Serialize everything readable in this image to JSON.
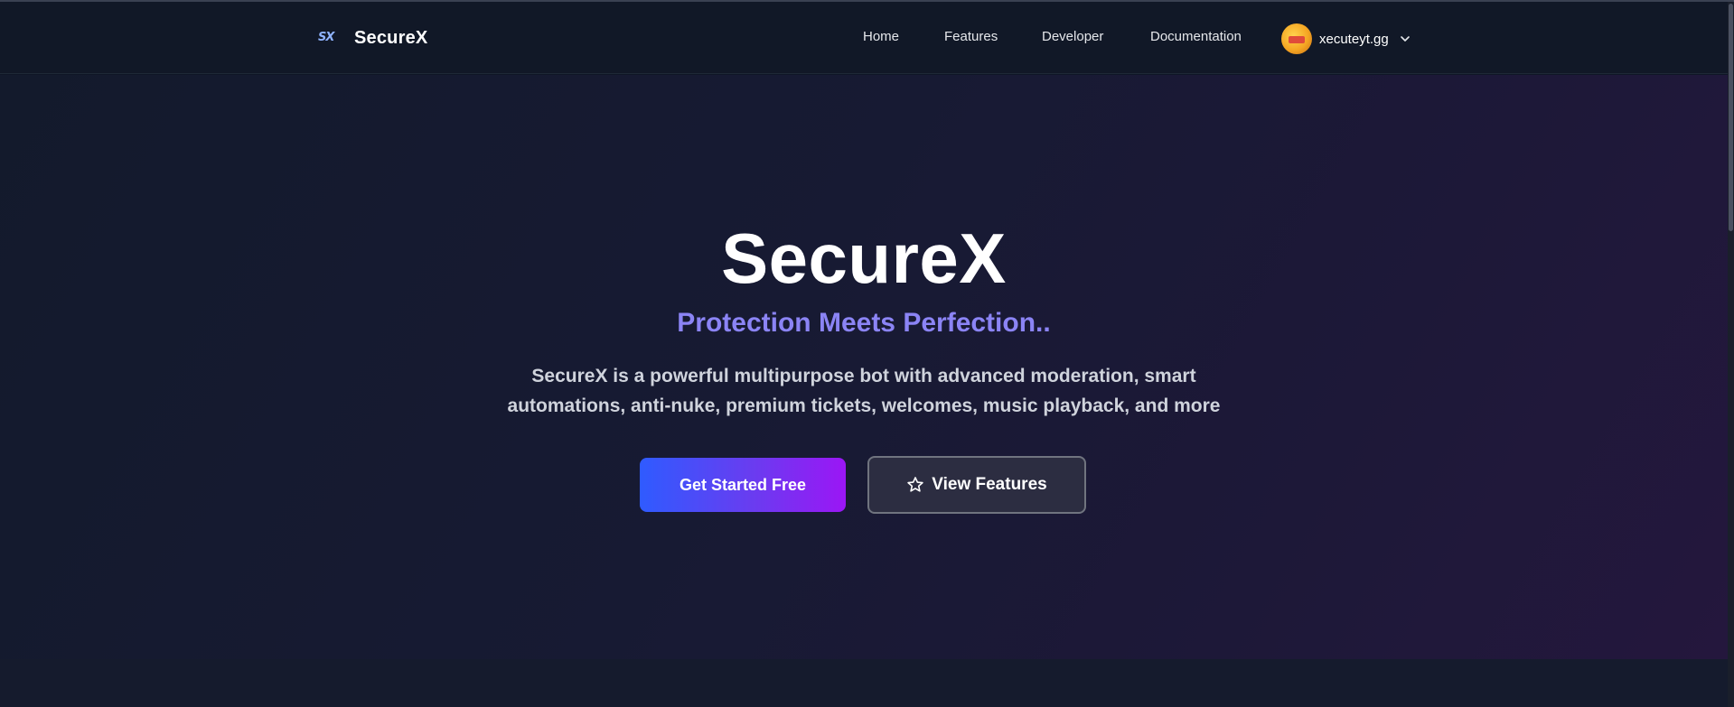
{
  "brand": {
    "logo_text": "SX",
    "name": "SecureX"
  },
  "nav": {
    "links": [
      {
        "label": "Home"
      },
      {
        "label": "Features"
      },
      {
        "label": "Developer"
      },
      {
        "label": "Documentation"
      }
    ],
    "user": {
      "username": "xecuteyt.gg"
    }
  },
  "hero": {
    "title": "SecureX",
    "subtitle": "Protection Meets Perfection..",
    "description_line1": "SecureX is a powerful multipurpose bot with advanced moderation, smart",
    "description_line2": "automations, anti-nuke, premium tickets, welcomes, music playback, and more",
    "primary_button": "Get Started Free",
    "secondary_button": "View Features"
  },
  "colors": {
    "accent_purple": "#8b84f5",
    "gradient_start": "#2f5bff",
    "gradient_end": "#9b16f5",
    "nav_bg": "#111827"
  },
  "icons": {
    "avatar": "user-avatar",
    "dropdown": "chevron-down-icon",
    "secondary_button": "star-icon"
  }
}
